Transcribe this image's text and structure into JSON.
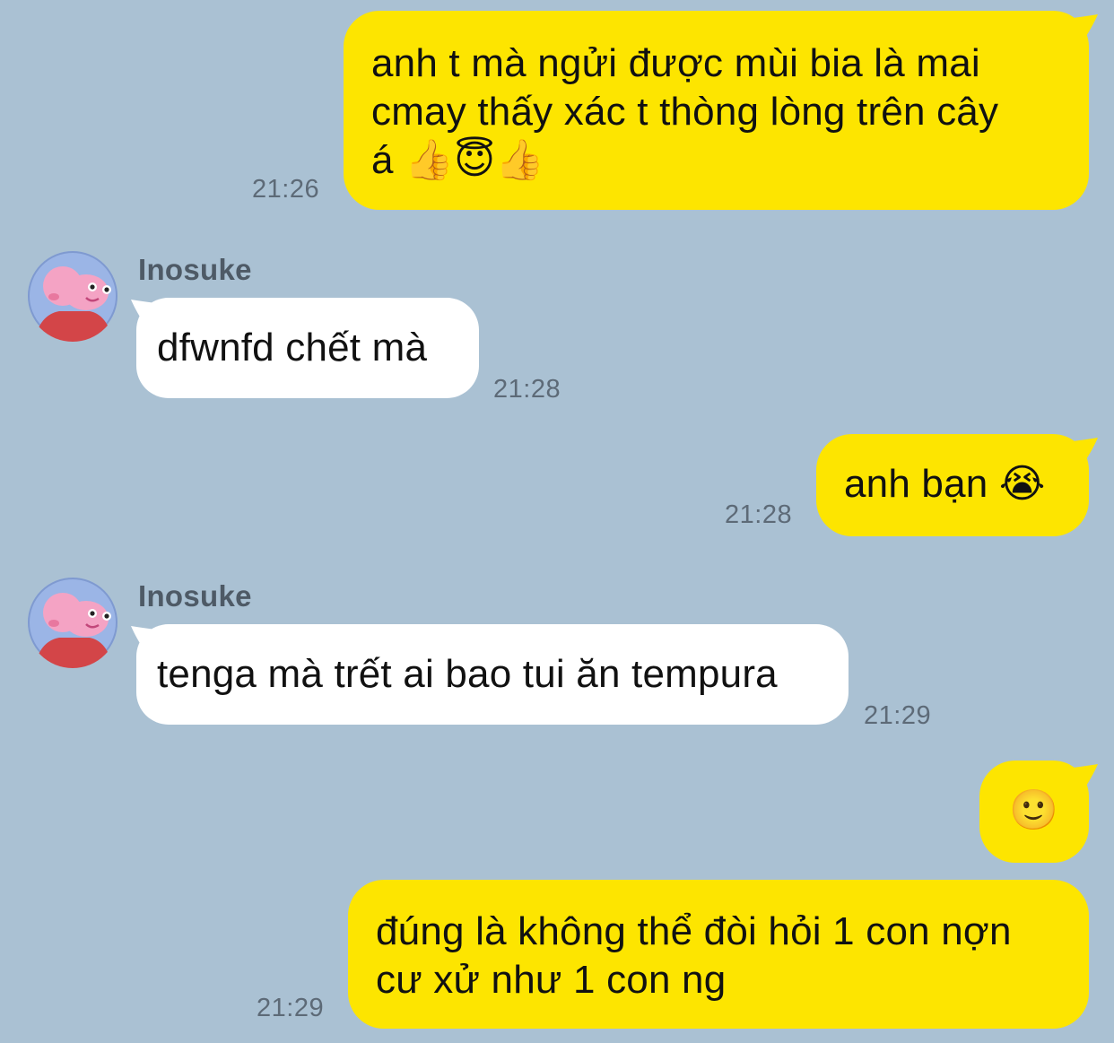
{
  "contact": {
    "name": "Inosuke"
  },
  "colors": {
    "background": "#aac1d3",
    "mine_bubble": "#fde500",
    "their_bubble": "#ffffff",
    "time_text": "#5d6a77"
  },
  "messages": [
    {
      "from": "me",
      "text": "anh t mà ngửi được mùi bia là mai\ncmay thấy xác t thòng lòng trên cây\ná 👍😇👍",
      "time": "21:26"
    },
    {
      "from": "Inosuke",
      "sender": "Inosuke",
      "text": "dfwnfd chết mà",
      "time": "21:28"
    },
    {
      "from": "me",
      "text": "anh bạn 😭",
      "time": "21:28"
    },
    {
      "from": "Inosuke",
      "sender": "Inosuke",
      "text": "tenga mà trết ai bao tui ăn tempura",
      "time": "21:29"
    },
    {
      "from": "me",
      "text": "🙂",
      "time": ""
    },
    {
      "from": "me",
      "text": "đúng là không thể đòi hỏi 1 con nợn\ncư xử như 1 con ng",
      "time": "21:29"
    }
  ]
}
